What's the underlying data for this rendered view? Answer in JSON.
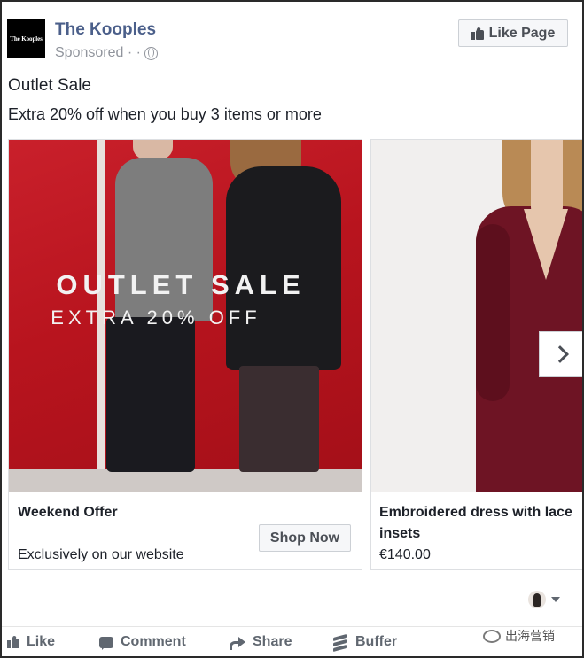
{
  "post": {
    "logo_text": "The Kooples",
    "page_name": "The Kooples",
    "sponsored": "Sponsored · ·",
    "like_page_label": "Like Page",
    "title": "Outlet Sale",
    "text": "Extra 20% off when you buy 3 items or more"
  },
  "carousel": {
    "cards": [
      {
        "image_headline": "OUTLET SALE",
        "image_subheadline": "EXTRA 20% OFF",
        "title": "Weekend Offer",
        "description": "Exclusively on our website",
        "cta_label": "Shop Now"
      },
      {
        "title": "Embroidered dress with lace insets",
        "description": "€140.00"
      }
    ]
  },
  "actions": {
    "like": "Like",
    "comment": "Comment",
    "share": "Share",
    "buffer": "Buffer"
  },
  "watermark": {
    "text": "出海营销"
  },
  "colors": {
    "page_name": "#4b5f8a",
    "action_text": "#606770",
    "ad_background": "#b8141e",
    "dress": "#6e1424"
  }
}
